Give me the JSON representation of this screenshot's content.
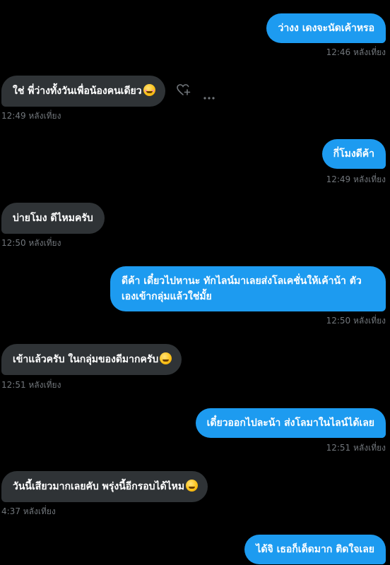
{
  "messages": [
    {
      "text": "ว่างง เดงจะนัดเค้าหรอ",
      "time": "12:46 หลังเที่ยง",
      "side": "out"
    },
    {
      "text": "ใช่ พี่ว่างทั้งวันเพื่อน้องคนเดียว",
      "emoji": "smiling-face-with-hearts-emoji",
      "time": "12:49 หลังเที่ยง",
      "side": "in"
    },
    {
      "text": "กี่โมงดีค้า",
      "time": "12:49 หลังเที่ยง",
      "side": "out"
    },
    {
      "text": "บ่ายโมง ดีไหมครับ",
      "time": "12:50 หลังเที่ยง",
      "side": "in"
    },
    {
      "text": "ดีค้า เดี๋ยวไปหานะ ทักไลน์มาเลยส่งโลเคชั่นให้เค้าน้า ตัวเองเข้ากลุ่มแล้วใช่มั้ย",
      "time": "12:50 หลังเที่ยง",
      "side": "out"
    },
    {
      "text": "เข้าแล้วครับ ในกลุ่มของดีมากครับ",
      "emoji": "face-blowing-kiss-emoji",
      "time": "12:51 หลังเที่ยง",
      "side": "in"
    },
    {
      "text": "เดี๋ยวออกไปละน้า ส่งโลมาในไลน์ได้เลย",
      "time": "12:51 หลังเที่ยง",
      "side": "out"
    },
    {
      "text": "วันนี้เสียวมากเลยคับ พรุ่งนี้อีกรอบได้ไหม",
      "emoji": "smiling-face-emoji",
      "time": "4:37 หลังเที่ยง",
      "side": "in"
    },
    {
      "text": "ได้จิ เธอก็เด็ดมาก ติดใจเลย",
      "side": "out"
    }
  ],
  "actions": {
    "react_icon": "heart-plus-icon",
    "more_icon": "more-horizontal-icon"
  },
  "colors": {
    "outgoing": "#1d9bf0",
    "incoming": "#2f3336",
    "timestamp": "#71767b",
    "background": "#000000"
  }
}
